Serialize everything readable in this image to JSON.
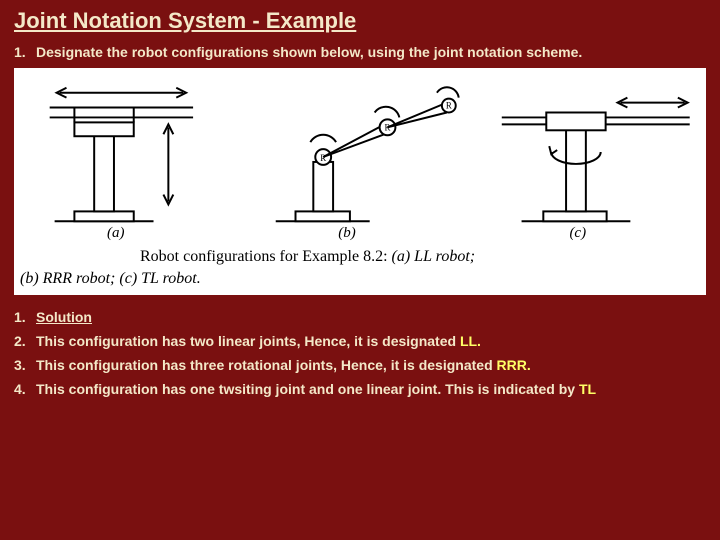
{
  "title": "Joint Notation System - Example",
  "q": {
    "num": "1.",
    "text": "Designate the robot configurations shown below, using the joint notation scheme."
  },
  "fig": {
    "a": "(a)",
    "b": "(b)",
    "c": "(c)",
    "caption_lead": "Robot configurations for Example 8.2: ",
    "caption_a": "(a) LL robot;",
    "caption_b": "(b) RRR robot; ",
    "caption_c": "(c) TL robot."
  },
  "sol": {
    "num": "1.",
    "text": "Solution"
  },
  "p2": {
    "num": "2.",
    "text": "This configuration has two linear joints, Hence, it is designated ",
    "hl": "LL."
  },
  "p3": {
    "num": "3.",
    "text": "This configuration has three rotational joints, Hence, it is designated ",
    "hl": "RRR."
  },
  "p4": {
    "num": "4.",
    "text": "This configuration has one twsiting joint and one linear joint. This is indicated by ",
    "hl": "TL"
  }
}
